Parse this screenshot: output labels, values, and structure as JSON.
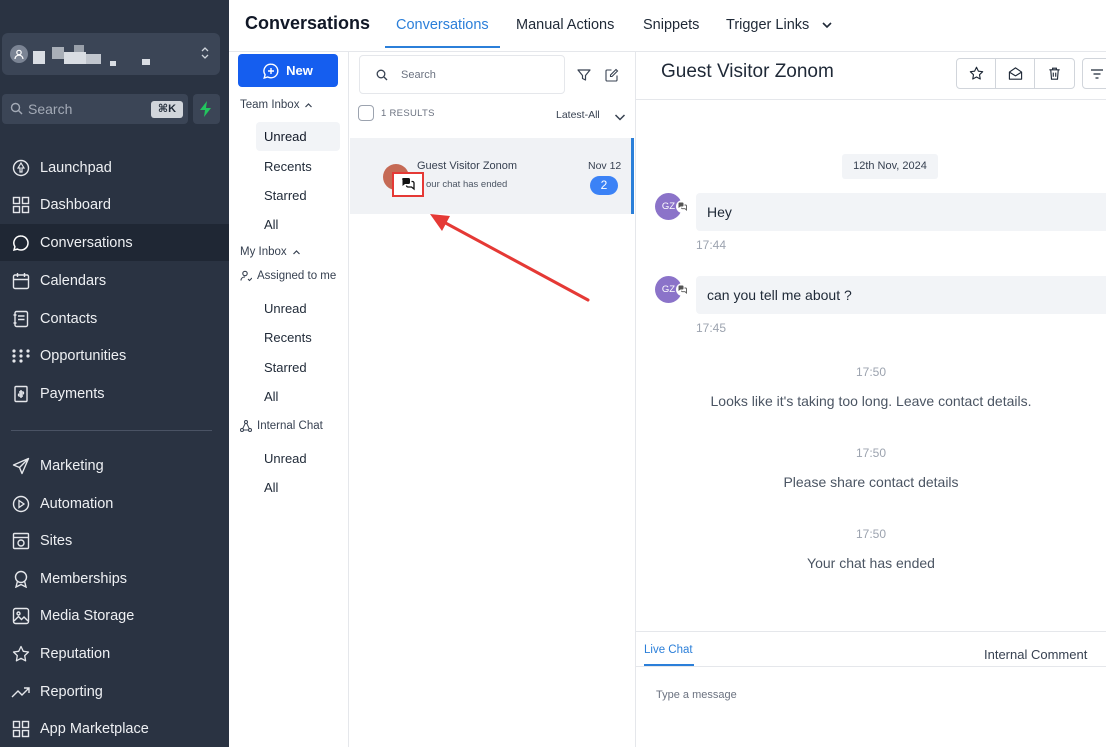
{
  "sidebar": {
    "search_placeholder": "Search",
    "shortcut": "⌘K",
    "items": [
      {
        "label": "Launchpad",
        "icon": "launchpad-icon"
      },
      {
        "label": "Dashboard",
        "icon": "dashboard-icon"
      },
      {
        "label": "Conversations",
        "icon": "conversations-icon",
        "active": true
      },
      {
        "label": "Calendars",
        "icon": "calendar-icon"
      },
      {
        "label": "Contacts",
        "icon": "contacts-icon"
      },
      {
        "label": "Opportunities",
        "icon": "opportunities-icon"
      },
      {
        "label": "Payments",
        "icon": "payments-icon"
      },
      {
        "label": "Marketing",
        "icon": "send-icon"
      },
      {
        "label": "Automation",
        "icon": "automation-icon"
      },
      {
        "label": "Sites",
        "icon": "sites-icon"
      },
      {
        "label": "Memberships",
        "icon": "badge-icon"
      },
      {
        "label": "Media Storage",
        "icon": "image-icon"
      },
      {
        "label": "Reputation",
        "icon": "star-icon"
      },
      {
        "label": "Reporting",
        "icon": "trend-icon"
      },
      {
        "label": "App Marketplace",
        "icon": "grid-icon"
      }
    ]
  },
  "header": {
    "title": "Conversations",
    "tabs": [
      "Conversations",
      "Manual Actions",
      "Snippets",
      "Trigger Links"
    ]
  },
  "inbox": {
    "new_label": "New",
    "team_inbox": "Team Inbox",
    "team_items": [
      "Unread",
      "Recents",
      "Starred",
      "All"
    ],
    "my_inbox": "My Inbox",
    "assigned": "Assigned to me",
    "assigned_items": [
      "Unread",
      "Recents",
      "Starred",
      "All"
    ],
    "internal_chat": "Internal Chat",
    "internal_items": [
      "Unread",
      "All"
    ]
  },
  "list": {
    "search_placeholder": "Search",
    "results": "1 RESULTS",
    "sort": "Latest-All",
    "conversation": {
      "name": "Guest Visitor Zonom",
      "preview": "our chat has ended",
      "date": "Nov 12",
      "count": "2"
    }
  },
  "chat": {
    "title": "Guest Visitor Zonom",
    "date_divider": "12th Nov, 2024",
    "avatar_initials": "GZ",
    "messages": [
      {
        "text": "Hey",
        "time": "17:44"
      },
      {
        "text": "can you tell me about ?",
        "time": "17:45"
      }
    ],
    "system": [
      {
        "time": "17:50",
        "text": "Looks like it's taking too long. Leave contact details."
      },
      {
        "time": "17:50",
        "text": "Please share contact details"
      },
      {
        "time": "17:50",
        "text": "Your chat has ended"
      }
    ],
    "composer": {
      "tab_live": "Live Chat",
      "tab_internal": "Internal Comment",
      "placeholder": "Type a message"
    }
  },
  "colors": {
    "accent": "#155eef",
    "sidebar_bg": "#2a3342",
    "annotation": "#e53935"
  }
}
